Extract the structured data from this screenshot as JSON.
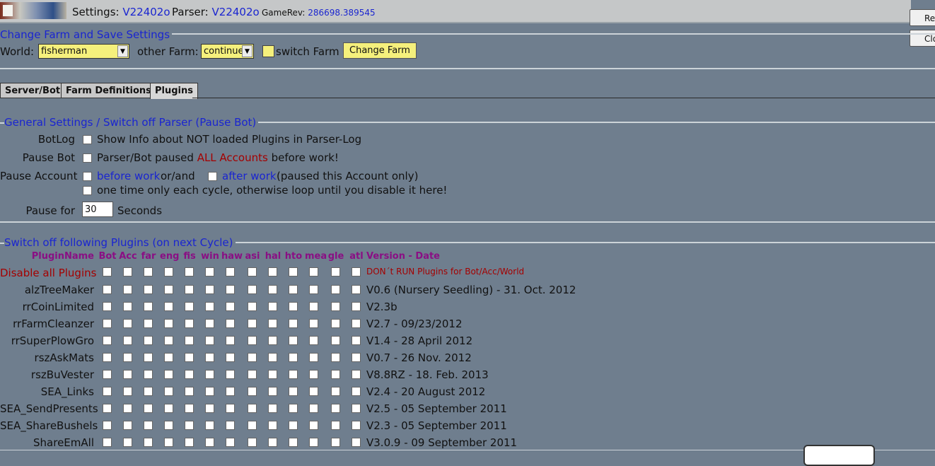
{
  "header": {
    "settings_label": "Settings:",
    "settings_version": "V22402o",
    "parser_label": "Parser:",
    "parser_version": "V22402o",
    "gamerev_label": "GameRev:",
    "gamerev_value": "286698.389545",
    "right_buttons": [
      "Refr",
      "Clo"
    ]
  },
  "farm_section": {
    "legend": "Change Farm and Save Settings",
    "world_label": "World:",
    "world_value": "fisherman",
    "other_farm_label": "other Farm:",
    "other_farm_value": "continue",
    "switch_farm_label": "switch Farm",
    "change_farm_button": "Change Farm"
  },
  "tabs": [
    "Server/Bot",
    "Farm Definitions",
    "Plugins"
  ],
  "active_tab": "Plugins",
  "general": {
    "legend": "General Settings / Switch off Parser (Pause Bot)",
    "botlog_label": "BotLog",
    "botlog_text": "Show Info about NOT loaded Plugins in Parser-Log",
    "pausebot_label": "Pause Bot",
    "pausebot_text_a": "Parser/Bot paused",
    "pausebot_text_red": "ALL Accounts",
    "pausebot_text_b": "before work!",
    "pauseacc_label": "Pause Account",
    "before_work": "before work",
    "or_and": "or/and",
    "after_work": "after work",
    "paused_note": "(paused this Account only)",
    "onetime_text": "one time only each cycle, otherwise loop until you disable it here!",
    "pausefor_label": "Pause for",
    "pausefor_value": "30",
    "seconds_label": "Seconds"
  },
  "plugins": {
    "legend": "Switch off following Plugins (on next Cycle)",
    "headers": {
      "name": "PluginName",
      "columns": [
        "Bot",
        "Acc",
        "far",
        "eng",
        "fis",
        "win",
        "haw",
        "asi",
        "hal",
        "hto",
        "mea",
        "gle",
        "atl"
      ],
      "version": "Version - Date"
    },
    "disable_all": {
      "name": "Disable all Plugins",
      "note": "DON´t RUN Plugins for Bot/Acc/World"
    },
    "rows": [
      {
        "name": "alzTreeMaker",
        "version": "V0.6 (Nursery Seedling) - 31. Oct. 2012"
      },
      {
        "name": "rrCoinLimited",
        "version": "V2.3b"
      },
      {
        "name": "rrFarmCleanzer",
        "version": "V2.7 - 09/23/2012"
      },
      {
        "name": "rrSuperPlowGro",
        "version": "V1.4 - 28 April 2012"
      },
      {
        "name": "rszAskMats",
        "version": "V0.7 - 26 Nov. 2012"
      },
      {
        "name": "rszBuVester",
        "version": "V8.8RZ - 18. Feb. 2013"
      },
      {
        "name": "SEA_Links",
        "version": "V2.4 - 20 August 2012"
      },
      {
        "name": "SEA_SendPresents",
        "version": "V2.5 - 05 September 2011"
      },
      {
        "name": "SEA_ShareBushels",
        "version": "V2.3 - 05 September 2011"
      },
      {
        "name": "ShareEmAll",
        "version": "V3.0.9 - 09 September 2011"
      }
    ]
  }
}
